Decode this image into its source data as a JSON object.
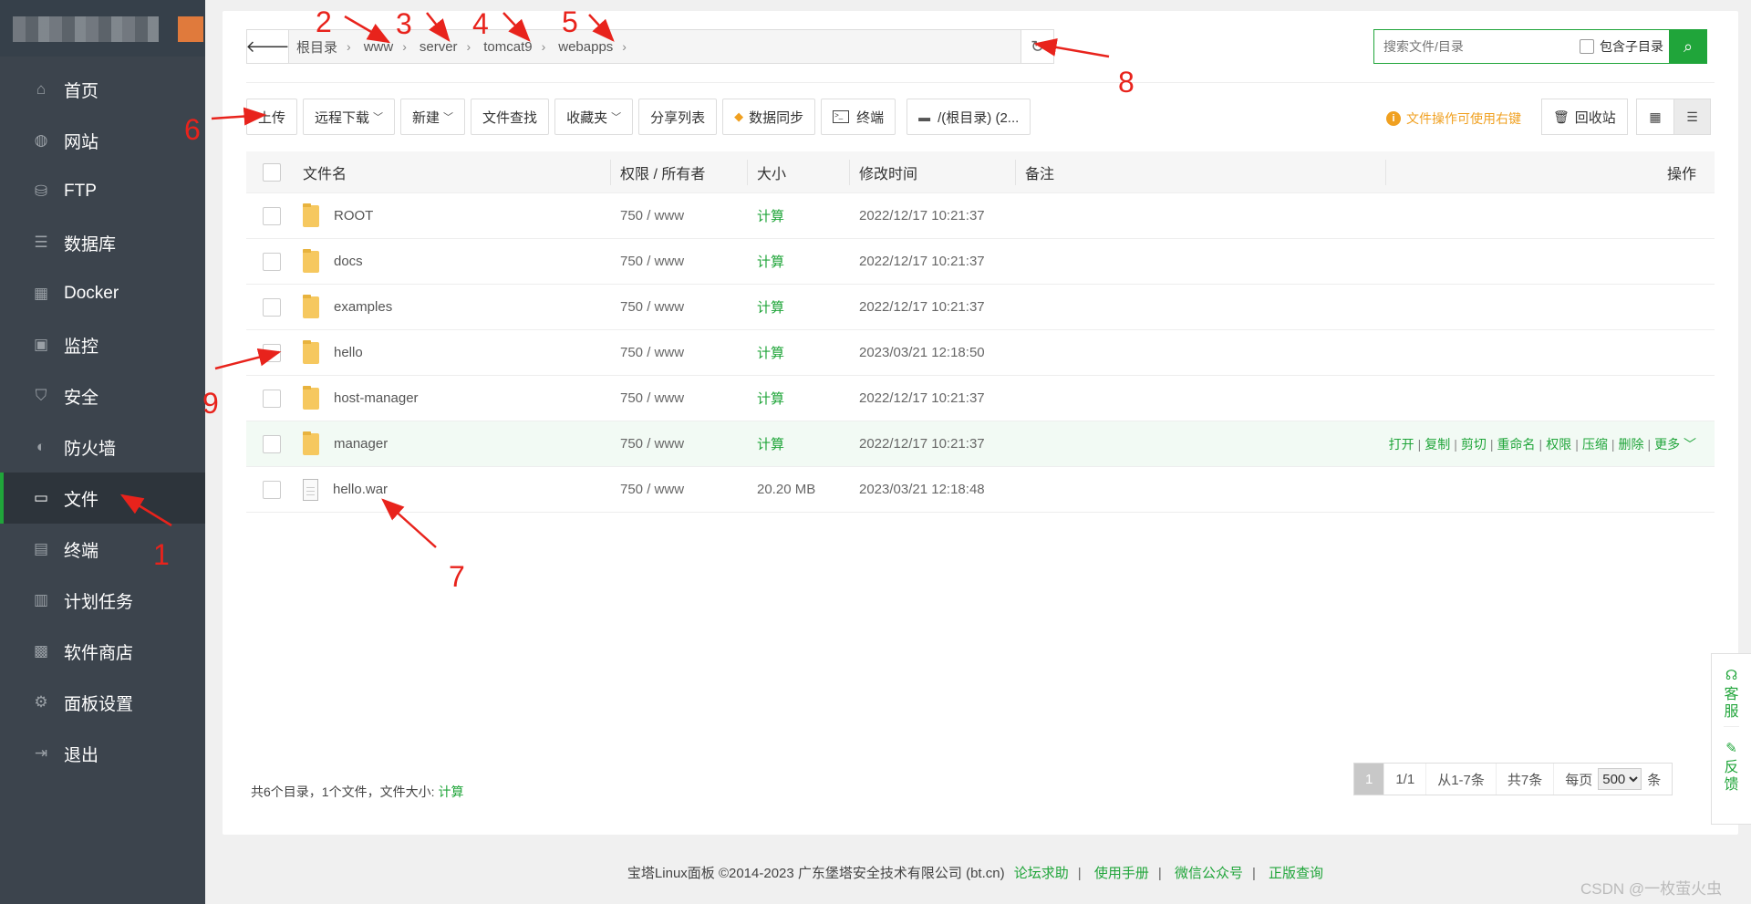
{
  "sidebar": {
    "items": [
      {
        "label": "首页",
        "icon": "home-icon"
      },
      {
        "label": "网站",
        "icon": "globe-icon"
      },
      {
        "label": "FTP",
        "icon": "ftp-icon"
      },
      {
        "label": "数据库",
        "icon": "database-icon"
      },
      {
        "label": "Docker",
        "icon": "docker-icon"
      },
      {
        "label": "监控",
        "icon": "monitor-icon"
      },
      {
        "label": "安全",
        "icon": "shield-icon"
      },
      {
        "label": "防火墙",
        "icon": "firewall-icon"
      },
      {
        "label": "文件",
        "icon": "folder-icon"
      },
      {
        "label": "终端",
        "icon": "terminal-icon"
      },
      {
        "label": "计划任务",
        "icon": "calendar-icon"
      },
      {
        "label": "软件商店",
        "icon": "apps-icon"
      },
      {
        "label": "面板设置",
        "icon": "gear-icon"
      },
      {
        "label": "退出",
        "icon": "logout-icon"
      }
    ],
    "active_index": 8,
    "accent": "#20a53a"
  },
  "pathbar": {
    "crumbs": [
      "根目录",
      "www",
      "server",
      "tomcat9",
      "webapps"
    ]
  },
  "search": {
    "placeholder": "搜索文件/目录",
    "subdir_label": "包含子目录"
  },
  "toolbar": {
    "upload": "上传",
    "remote_download": "远程下载",
    "new": "新建",
    "find": "文件查找",
    "favorites": "收藏夹",
    "share_list": "分享列表",
    "data_sync": "数据同步",
    "terminal": "终端",
    "path": "/(根目录) (2..."
  },
  "tip": "文件操作可使用右键",
  "recycle": "回收站",
  "table": {
    "headers": {
      "name": "文件名",
      "perm": "权限 / 所有者",
      "size": "大小",
      "time": "修改时间",
      "note": "备注",
      "ops": "操作"
    },
    "rows": [
      {
        "name": "ROOT",
        "type": "folder",
        "perm": "750 / www",
        "size": "计算",
        "time": "2022/12/17 10:21:37"
      },
      {
        "name": "docs",
        "type": "folder",
        "perm": "750 / www",
        "size": "计算",
        "time": "2022/12/17 10:21:37"
      },
      {
        "name": "examples",
        "type": "folder",
        "perm": "750 / www",
        "size": "计算",
        "time": "2022/12/17 10:21:37"
      },
      {
        "name": "hello",
        "type": "folder",
        "perm": "750 / www",
        "size": "计算",
        "time": "2023/03/21 12:18:50"
      },
      {
        "name": "host-manager",
        "type": "folder",
        "perm": "750 / www",
        "size": "计算",
        "time": "2022/12/17 10:21:37"
      },
      {
        "name": "manager",
        "type": "folder",
        "perm": "750 / www",
        "size": "计算",
        "time": "2022/12/17 10:21:37"
      },
      {
        "name": "hello.war",
        "type": "file",
        "perm": "750 / www",
        "size": "20.20 MB",
        "time": "2023/03/21 12:18:48"
      }
    ],
    "row_ops": [
      "打开",
      "复制",
      "剪切",
      "重命名",
      "权限",
      "压缩",
      "删除",
      "更多"
    ]
  },
  "summary": {
    "text": "共6个目录，1个文件，文件大小:",
    "calc": "计算"
  },
  "pager": {
    "current": "1",
    "pages": "1/1",
    "range": "从1-7条",
    "total": "共7条",
    "per_page_label": "每页",
    "per_page": "500",
    "unit": "条"
  },
  "footer": {
    "copyright": "宝塔Linux面板 ©2014-2023 广东堡塔安全技术有限公司 (bt.cn)",
    "links": [
      "论坛求助",
      "使用手册",
      "微信公众号",
      "正版查询"
    ]
  },
  "float": {
    "service": "客服",
    "feedback": "反馈"
  },
  "watermark": "CSDN @一枚萤火虫",
  "annotations": [
    "1",
    "2",
    "3",
    "4",
    "5",
    "6",
    "7",
    "8",
    "9"
  ]
}
